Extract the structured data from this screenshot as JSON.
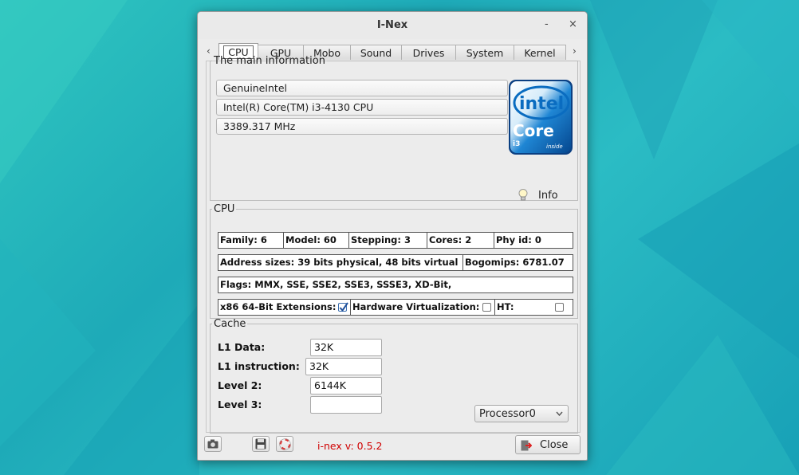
{
  "window": {
    "title": "I-Nex",
    "minimize": "-",
    "close": "×"
  },
  "tabs": [
    {
      "label": "CPU",
      "active": true
    },
    {
      "label": "GPU"
    },
    {
      "label": "Mobo"
    },
    {
      "label": "Sound"
    },
    {
      "label": "Drives"
    },
    {
      "label": "System"
    },
    {
      "label": "Kernel"
    }
  ],
  "main_info": {
    "legend": "The main information",
    "vendor": "GenuineIntel",
    "model": "Intel(R) Core(TM) i3-4130 CPU",
    "speed": "3389.317 MHz",
    "logo": {
      "brand": "intel",
      "line": "Core",
      "tier": "i3",
      "suffix": "inside"
    },
    "info_label": "Info"
  },
  "cpu": {
    "legend": "CPU",
    "family": "Family:  6",
    "model": "Model:  60",
    "stepping": "Stepping:  3",
    "cores": "Cores:  2",
    "phy_id": "Phy id:  0",
    "address_sizes": "Address sizes:  39 bits physical, 48 bits virtual",
    "bogomips": "Bogomips:  6781.07",
    "flags": "Flags: MMX, SSE, SSE2, SSE3, SSSE3, XD-Bit,",
    "x86_64_label": "x86 64-Bit Extensions:",
    "x86_64_checked": true,
    "hw_virt_label": "Hardware Virtualization:",
    "hw_virt_checked": false,
    "ht_label": "HT:",
    "ht_checked": false
  },
  "cache": {
    "legend": "Cache",
    "l1d_label": "L1 Data:",
    "l1d_value": "32K",
    "l1i_label": "L1 instruction:",
    "l1i_value": "32K",
    "l2_label": "Level 2:",
    "l2_value": "6144K",
    "l3_label": "Level 3:",
    "l3_value": "",
    "processor_select": "Processor0"
  },
  "bottom": {
    "version": "i-nex v: 0.5.2",
    "close_label": "Close"
  },
  "colors": {
    "version_text": "#d00000",
    "intel_blue": "#0a6cc0"
  }
}
